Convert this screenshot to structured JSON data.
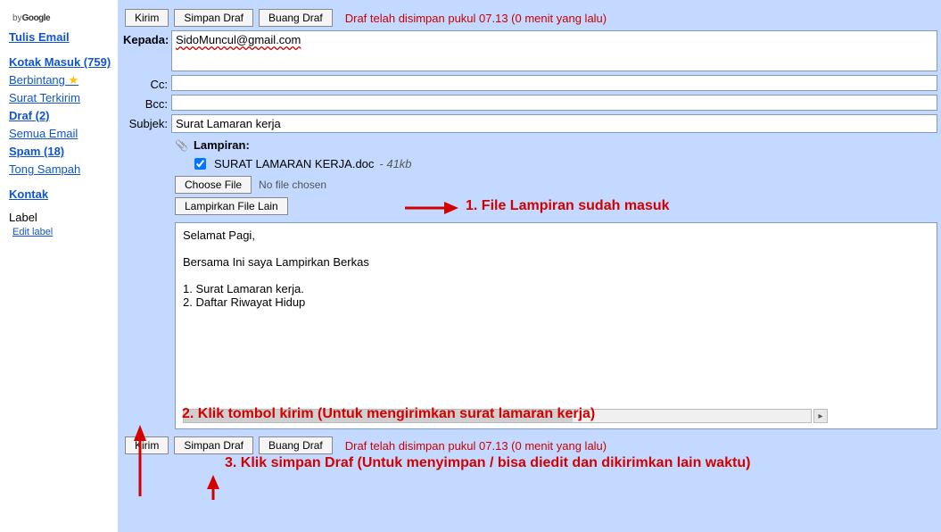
{
  "branding": {
    "by": "by",
    "google": "Google"
  },
  "sidebar": {
    "tulis_email": "Tulis Email",
    "kotak_masuk": "Kotak Masuk (759)",
    "berbintang": "Berbintang",
    "surat_terkirim": "Surat Terkirim",
    "draf": "Draf (2)",
    "semua_email": "Semua Email",
    "spam": "Spam (18)",
    "tong_sampah": "Tong Sampah",
    "kontak": "Kontak",
    "label_hd": "Label",
    "edit_label": "Edit label"
  },
  "buttons": {
    "kirim": "Kirim",
    "simpan_draf": "Simpan Draf",
    "buang_draf": "Buang Draf",
    "choose_file": "Choose File",
    "no_file": "No file chosen",
    "lampirkan_lain": "Lampirkan File Lain"
  },
  "status": "Draf telah disimpan pukul 07.13 (0 menit yang lalu)",
  "labels": {
    "kepada": "Kepada:",
    "cc": "Cc:",
    "bcc": "Bcc:",
    "subjek": "Subjek:",
    "lampiran": "Lampiran:"
  },
  "fields": {
    "to": "SidoMuncul@gmail.com",
    "subject": "Surat Lamaran kerja"
  },
  "attachment": {
    "name": "SURAT LAMARAN KERJA.doc",
    "size": " - 41kb"
  },
  "body": {
    "l1": "Selamat Pagi,",
    "l2": "Bersama Ini saya Lampirkan Berkas",
    "l3": "1. Surat Lamaran kerja.",
    "l4": "2. Daftar Riwayat Hidup"
  },
  "annotations": {
    "a1": "1. File Lampiran sudah masuk",
    "a2": "2. Klik tombol kirim (Untuk mengirimkan surat lamaran kerja)",
    "a3": "3. Klik simpan Draf (Untuk menyimpan / bisa diedit dan dikirimkan lain waktu)"
  }
}
